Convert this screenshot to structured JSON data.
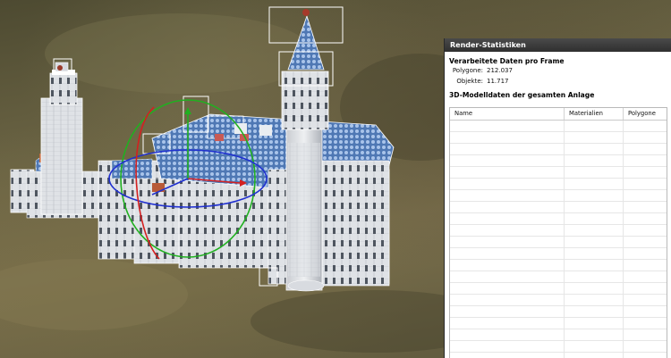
{
  "panel": {
    "title": "Render-Statistiken",
    "frame_section_title": "Verarbeitete Daten pro Frame",
    "stats": [
      {
        "label": "Polygone:",
        "value": "212.037"
      },
      {
        "label": "Objekte:",
        "value": "11.717"
      }
    ],
    "model_section_title": "3D-Modelldaten der gesamten Anlage",
    "table": {
      "columns": [
        "Name",
        "Materialien",
        "Polygone"
      ],
      "rows": []
    }
  },
  "viewport": {
    "gizmo_colors": {
      "x_axis": "#d42020",
      "y_axis": "#20b020",
      "z_axis": "#2030d0"
    },
    "selection_color": "#ffffff"
  }
}
